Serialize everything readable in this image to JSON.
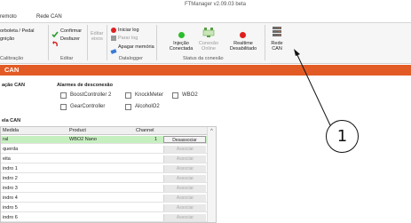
{
  "window": {
    "title": "FTManager v2.09.03 beta"
  },
  "menu": {
    "items": [
      "remoto",
      "Rede CAN"
    ]
  },
  "ribbon": {
    "group1": {
      "line1": "orboleta / Pedal",
      "line2": "gnição",
      "label": "Calibração"
    },
    "group2": {
      "confirm": "Confirmar",
      "undo": "Desfazer",
      "label": "Editar"
    },
    "group3": {
      "edit_dim": "Editar",
      "edit_dim2": "eixos",
      "start_log": "Iniciar log",
      "stop_log": "Parar log",
      "clear_memory": "Apagar memória",
      "label": "Datalogger"
    },
    "group4": {
      "injection": [
        "Injeção",
        "Conectada"
      ],
      "can_conn": [
        "Conexão",
        "Online"
      ],
      "realtime": [
        "Realtime",
        "Desabilitado"
      ],
      "label": "Status da conexão"
    },
    "group5": {
      "rede": [
        "Rede",
        "CAN"
      ]
    }
  },
  "colors": {
    "accent": "#e35b24",
    "status_green": "#2bbd2b",
    "status_red": "#e01e1e",
    "selected_row": "#c6efc0"
  },
  "section_header": "CAN",
  "config": {
    "left_title": "ação CAN",
    "disconnect_title": "Alarmes de desconexão",
    "checkboxes": [
      "BoostController 2",
      "KnockMeter",
      "WBO2",
      "GearController",
      "AlcoholO2"
    ]
  },
  "table": {
    "title": "ela CAN",
    "columns": [
      "Medida",
      "Product",
      "Channel"
    ],
    "rows": [
      {
        "medida": "ral",
        "product": "WBO2 Nano",
        "channel": "1",
        "action": "Desassociar",
        "selected": true
      },
      {
        "medida": "querda",
        "product": "",
        "channel": "",
        "action": "Associar",
        "selected": false
      },
      {
        "medida": "eita",
        "product": "",
        "channel": "",
        "action": "Associar",
        "selected": false
      },
      {
        "medida": "indro 1",
        "product": "",
        "channel": "",
        "action": "Associar",
        "selected": false
      },
      {
        "medida": "indro 2",
        "product": "",
        "channel": "",
        "action": "Associar",
        "selected": false
      },
      {
        "medida": "indro 3",
        "product": "",
        "channel": "",
        "action": "Associar",
        "selected": false
      },
      {
        "medida": "indro 4",
        "product": "",
        "channel": "",
        "action": "Associar",
        "selected": false
      },
      {
        "medida": "indro 5",
        "product": "",
        "channel": "",
        "action": "Associar",
        "selected": false
      },
      {
        "medida": "indro 6",
        "product": "",
        "channel": "",
        "action": "Associar",
        "selected": false
      }
    ]
  },
  "callout": {
    "number": "1"
  }
}
